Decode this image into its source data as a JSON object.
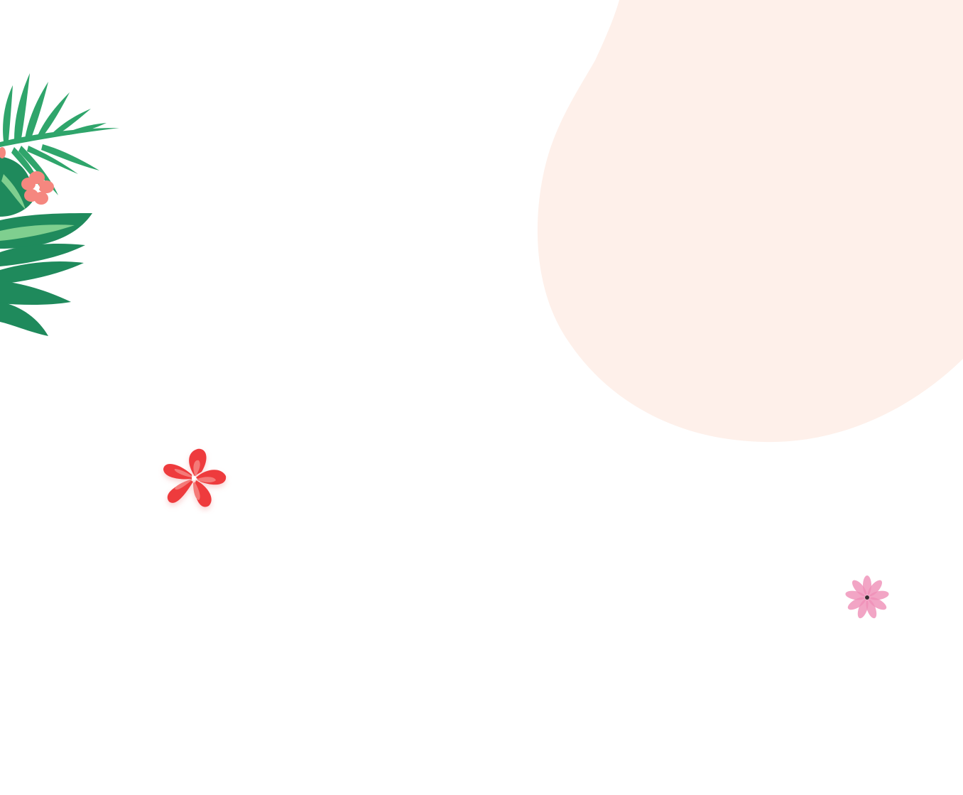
{
  "colors": {
    "background": "#ffffff",
    "blob": "#fef0ea",
    "leaf_dark": "#1f8a5c",
    "leaf_mid": "#2fa56b",
    "leaf_light": "#7fcf8f",
    "hibiscus_red": "#ee3b3e",
    "hibiscus_light": "#f47a78",
    "small_hibiscus": "#f5877f",
    "pink_flower": "#ef8fb6"
  },
  "decorations": [
    {
      "icon": "tropical-leaves-icon"
    },
    {
      "icon": "hibiscus-flower-icon"
    },
    {
      "icon": "pink-flower-icon"
    }
  ]
}
